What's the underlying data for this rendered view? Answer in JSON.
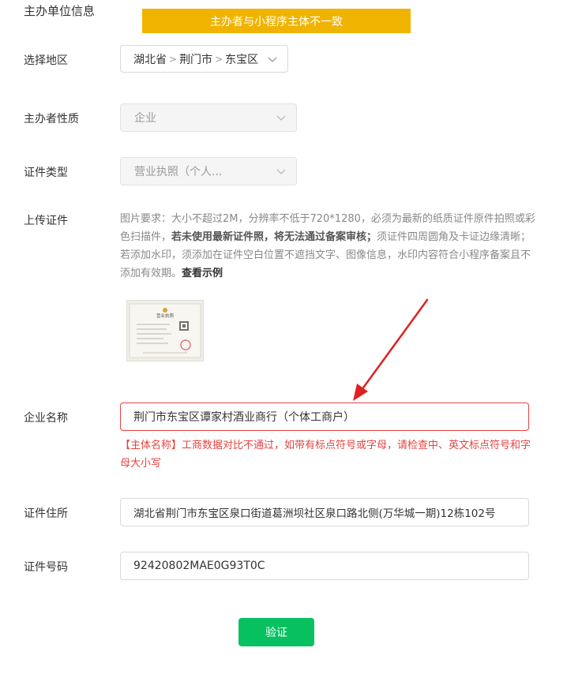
{
  "section_title": "主办单位信息",
  "warning_banner": "主办者与小程序主体不一致",
  "colors": {
    "banner": "#f0b400",
    "error": "#e64340",
    "primary_button": "#07c160",
    "arrow": "#e02020"
  },
  "region": {
    "label": "选择地区",
    "province": "湖北省",
    "city": "荆门市",
    "district": "东宝区",
    "separator": ">",
    "icon": "chevron-down-icon"
  },
  "nature": {
    "label": "主办者性质",
    "value": "企业",
    "icon": "chevron-down-icon"
  },
  "cert_type": {
    "label": "证件类型",
    "value": "营业执照（个人...",
    "icon": "chevron-down-icon"
  },
  "upload": {
    "label": "上传证件",
    "desc_part1": "图片要求：大小不超过2M，分辨率不低于720*1280，必须为最新的纸质证件原件拍照或彩色扫描件，",
    "desc_bold": "若未使用最新证件照，将无法通过备案审核；",
    "desc_part2": "须证件四周圆角及卡证边缘清晰；若添加水印，须添加在证件空白位置不遮挡文字、图像信息，水印内容符合小程序备案且不添加有效期。",
    "example_link": "查看示例",
    "thumbnail_title": "营业执照"
  },
  "company": {
    "label": "企业名称",
    "value": "荆门市东宝区谭家村酒业商行（个体工商户）",
    "error": "【主体名称】工商数据对比不通过，如带有标点符号或字母，请检查中、英文标点符号和字母大小写"
  },
  "address": {
    "label": "证件住所",
    "value": "湖北省荆门市东宝区泉口街道葛洲坝社区泉口路北侧(万华城一期)12栋102号"
  },
  "cert_number": {
    "label": "证件号码",
    "value": "92420802MAE0G93T0C"
  },
  "verify_button": "验证"
}
